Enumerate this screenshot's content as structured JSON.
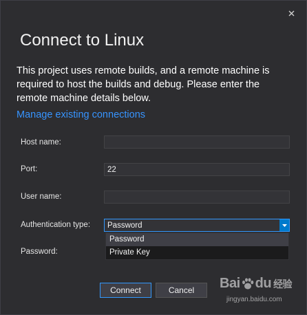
{
  "dialog": {
    "title": "Connect to Linux",
    "description": "This project uses remote builds, and a remote machine is required to host the builds and debug. Please enter the remote machine details below.",
    "manage_link": "Manage existing connections"
  },
  "fields": {
    "host_name": {
      "label": "Host name:",
      "value": ""
    },
    "port": {
      "label": "Port:",
      "value": "22"
    },
    "user_name": {
      "label": "User name:",
      "value": ""
    },
    "auth_type": {
      "label": "Authentication type:",
      "value": "Password"
    },
    "password": {
      "label": "Password:"
    }
  },
  "dropdown": {
    "options": [
      "Password",
      "Private Key"
    ],
    "selected": "Password"
  },
  "buttons": {
    "connect": "Connect",
    "cancel": "Cancel"
  },
  "watermark": {
    "logo_text": "Bai",
    "logo_text2": "du",
    "logo_cn": "经验",
    "url": "jingyan.baidu.com"
  },
  "colors": {
    "background": "#2d2d30",
    "accent": "#007acc",
    "link": "#3794ff",
    "input_bg": "#333337"
  },
  "icons": {
    "close": "close-icon",
    "dropdown": "chevron-down-icon"
  }
}
